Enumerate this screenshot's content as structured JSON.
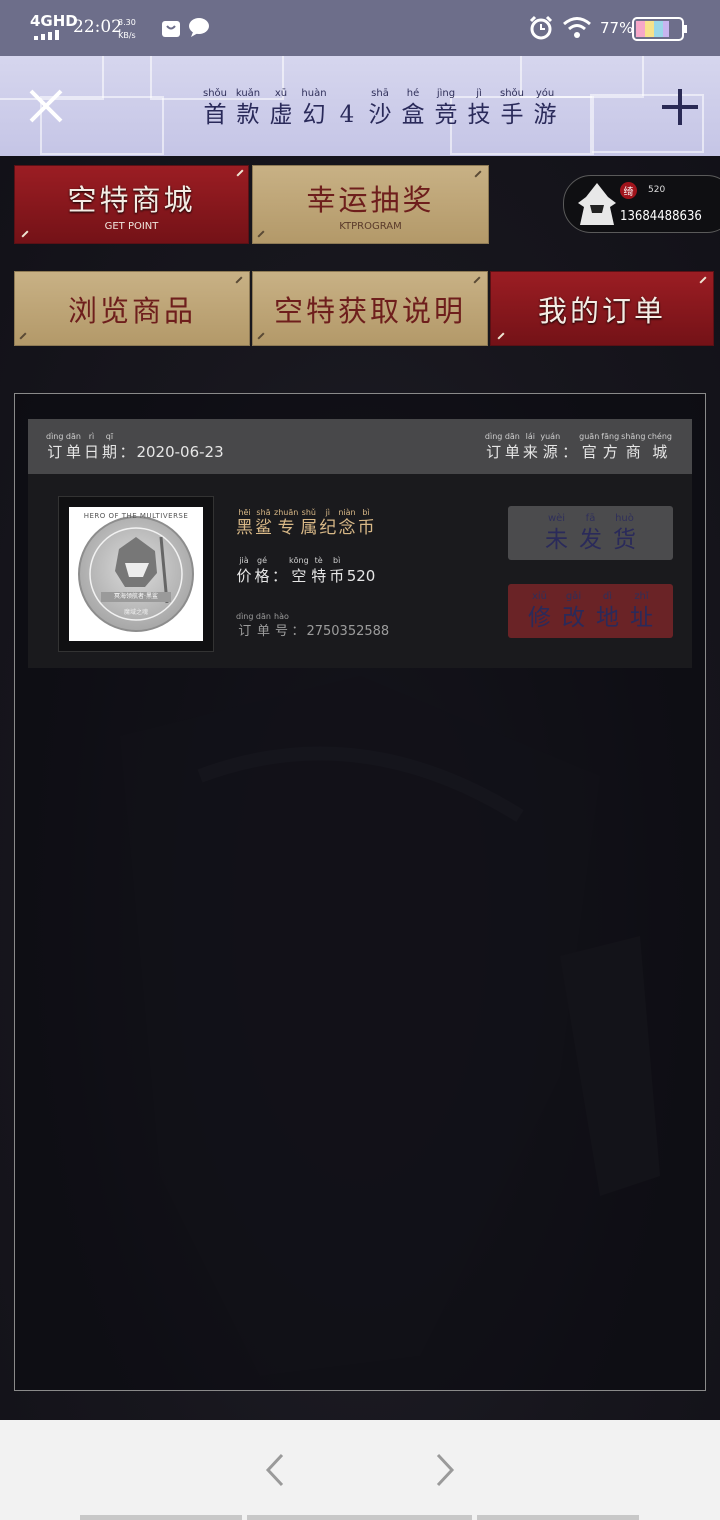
{
  "status_bar": {
    "network": "4GHD",
    "time": "22:02",
    "speed_value": "3.30",
    "speed_unit": "KB/s",
    "battery_percent": "77%",
    "icons": [
      "signal-icon",
      "shopping-bag-icon",
      "message-icon",
      "alarm-icon",
      "wifi-icon",
      "battery-icon"
    ]
  },
  "header": {
    "title_chars": [
      {
        "py": "shǒu",
        "hz": "首"
      },
      {
        "py": "kuǎn",
        "hz": "款"
      },
      {
        "py": "xū",
        "hz": "虚"
      },
      {
        "py": "huàn",
        "hz": "幻"
      },
      {
        "py": "",
        "hz": "4"
      },
      {
        "py": "shā",
        "hz": "沙"
      },
      {
        "py": "hé",
        "hz": "盒"
      },
      {
        "py": "jìng",
        "hz": "竞"
      },
      {
        "py": "jì",
        "hz": "技"
      },
      {
        "py": "shǒu",
        "hz": "手"
      },
      {
        "py": "yóu",
        "hz": "游"
      }
    ],
    "close_icon": "close-icon",
    "add_icon": "plus-icon"
  },
  "menu": {
    "shop": {
      "label": "空特商城",
      "sub": "GET POINT"
    },
    "lottery": {
      "label": "幸运抽奖",
      "sub": "KTPROGRAM"
    },
    "browse": {
      "label": "浏览商品"
    },
    "instructions": {
      "label": "空特获取说明"
    },
    "orders": {
      "label": "我的订单"
    }
  },
  "user": {
    "badge_text": "绮",
    "score": "520",
    "phone": "13684488636"
  },
  "order": {
    "date_label": [
      {
        "py": "dìng",
        "hz": "订"
      },
      {
        "py": "dān",
        "hz": "单"
      },
      {
        "py": "rì",
        "hz": "日"
      },
      {
        "py": "qī",
        "hz": "期"
      }
    ],
    "date_value": "2020-06-23",
    "source_label": [
      {
        "py": "dìng",
        "hz": "订"
      },
      {
        "py": "dān",
        "hz": "单"
      },
      {
        "py": "lái",
        "hz": "来"
      },
      {
        "py": "yuán",
        "hz": "源"
      }
    ],
    "source_value": [
      {
        "py": "guān",
        "hz": "官"
      },
      {
        "py": "fāng",
        "hz": "方"
      },
      {
        "py": "shāng",
        "hz": "商"
      },
      {
        "py": "chéng",
        "hz": "城"
      }
    ],
    "product_name": [
      {
        "py": "hēi",
        "hz": "黑"
      },
      {
        "py": "shā",
        "hz": "鲨"
      },
      {
        "py": "zhuān",
        "hz": "专"
      },
      {
        "py": "shǔ",
        "hz": "属"
      },
      {
        "py": "jì",
        "hz": "纪"
      },
      {
        "py": "niàn",
        "hz": "念"
      },
      {
        "py": "bì",
        "hz": "币"
      }
    ],
    "price_label": [
      {
        "py": "jià",
        "hz": "价"
      },
      {
        "py": "gé",
        "hz": "格"
      }
    ],
    "price_currency": [
      {
        "py": "kōng",
        "hz": "空"
      },
      {
        "py": "tè",
        "hz": "特"
      },
      {
        "py": "bì",
        "hz": "币"
      }
    ],
    "price_value": "520",
    "number_label": [
      {
        "py": "dìng",
        "hz": "订"
      },
      {
        "py": "dān",
        "hz": "单"
      },
      {
        "py": "hào",
        "hz": "号"
      }
    ],
    "number_value": "2750352588",
    "coin_text_top": "HERO OF THE MULTIVERSE",
    "coin_text_mid": "冥海领航者·黑鲨",
    "coin_text_bot": "魔域之魂",
    "status_button": [
      {
        "py": "wèi",
        "hz": "未"
      },
      {
        "py": "fā",
        "hz": "发"
      },
      {
        "py": "huò",
        "hz": "货"
      }
    ],
    "edit_button": [
      {
        "py": "xiū",
        "hz": "修"
      },
      {
        "py": "gǎi",
        "hz": "改"
      },
      {
        "py": "dì",
        "hz": "地"
      },
      {
        "py": "zhǐ",
        "hz": "址"
      }
    ]
  },
  "bottom_nav": {
    "back_icon": "chevron-left-icon",
    "forward_icon": "chevron-right-icon"
  },
  "colors": {
    "status_bar": "#6d6e8a",
    "accent_red": "#8b1a1f",
    "accent_tan": "#c0a878",
    "product_gold": "#d8b887"
  }
}
